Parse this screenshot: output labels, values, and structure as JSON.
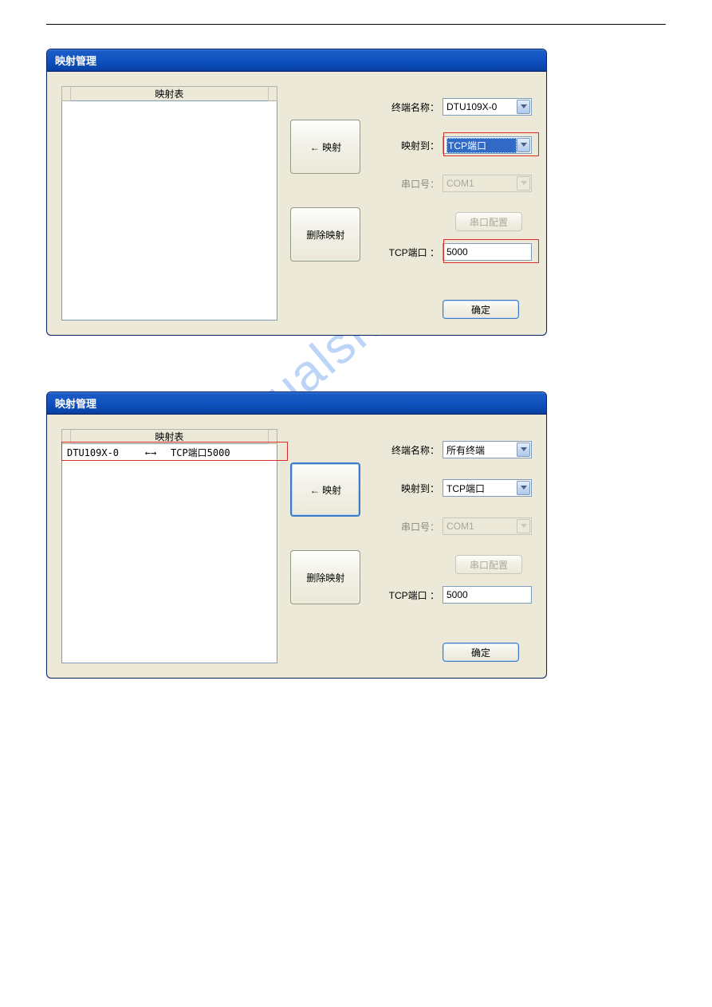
{
  "watermark": "manualshive.com",
  "dialog1": {
    "title": "映射管理",
    "list_header": "映射表",
    "rows": [],
    "btn_map": "← 映射",
    "btn_delete": "删除映射",
    "labels": {
      "terminal": "终端名称：",
      "map_to": "映射到：",
      "com_port": "串口号：",
      "com_cfg": "串口配置",
      "tcp_port": "TCP端口 ："
    },
    "values": {
      "terminal": "DTU109X-0",
      "map_to": "TCP端口",
      "com_port": "COM1",
      "tcp_port": "5000"
    },
    "ok": "确定"
  },
  "dialog2": {
    "title": "映射管理",
    "list_header": "映射表",
    "rows": [
      {
        "left": "DTU109X-0",
        "arrow": "←→",
        "right": "TCP端口5000"
      }
    ],
    "btn_map": "← 映射",
    "btn_delete": "删除映射",
    "labels": {
      "terminal": "终端名称：",
      "map_to": "映射到：",
      "com_port": "串口号：",
      "com_cfg": "串口配置",
      "tcp_port": "TCP端口 ："
    },
    "values": {
      "terminal": "所有终端",
      "map_to": "TCP端口",
      "com_port": "COM1",
      "tcp_port": "5000"
    },
    "ok": "确定"
  }
}
